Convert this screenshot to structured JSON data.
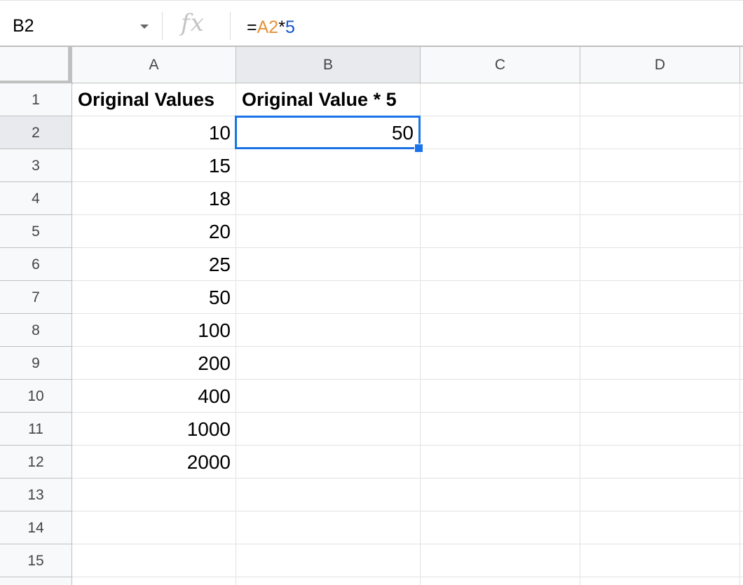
{
  "formula_bar": {
    "name_box": "B2",
    "fx_label": "fx",
    "formula": {
      "eq": "=",
      "ref": "A2",
      "op": "*",
      "num": "5"
    }
  },
  "columns": [
    "A",
    "B",
    "C",
    "D"
  ],
  "rows": [
    "1",
    "2",
    "3",
    "4",
    "5",
    "6",
    "7",
    "8",
    "9",
    "10",
    "11",
    "12",
    "13",
    "14",
    "15"
  ],
  "cells": {
    "A1": "Original Values",
    "B1": "Original Value * 5",
    "A2": "10",
    "B2": "50",
    "A3": "15",
    "A4": "18",
    "A5": "20",
    "A6": "25",
    "A7": "50",
    "A8": "100",
    "A9": "200",
    "A10": "400",
    "A11": "1000",
    "A12": "2000"
  },
  "selected_cell": "B2",
  "colors": {
    "selection": "#1a73e8",
    "cell_ref": "#e69138",
    "number": "#1155cc"
  }
}
